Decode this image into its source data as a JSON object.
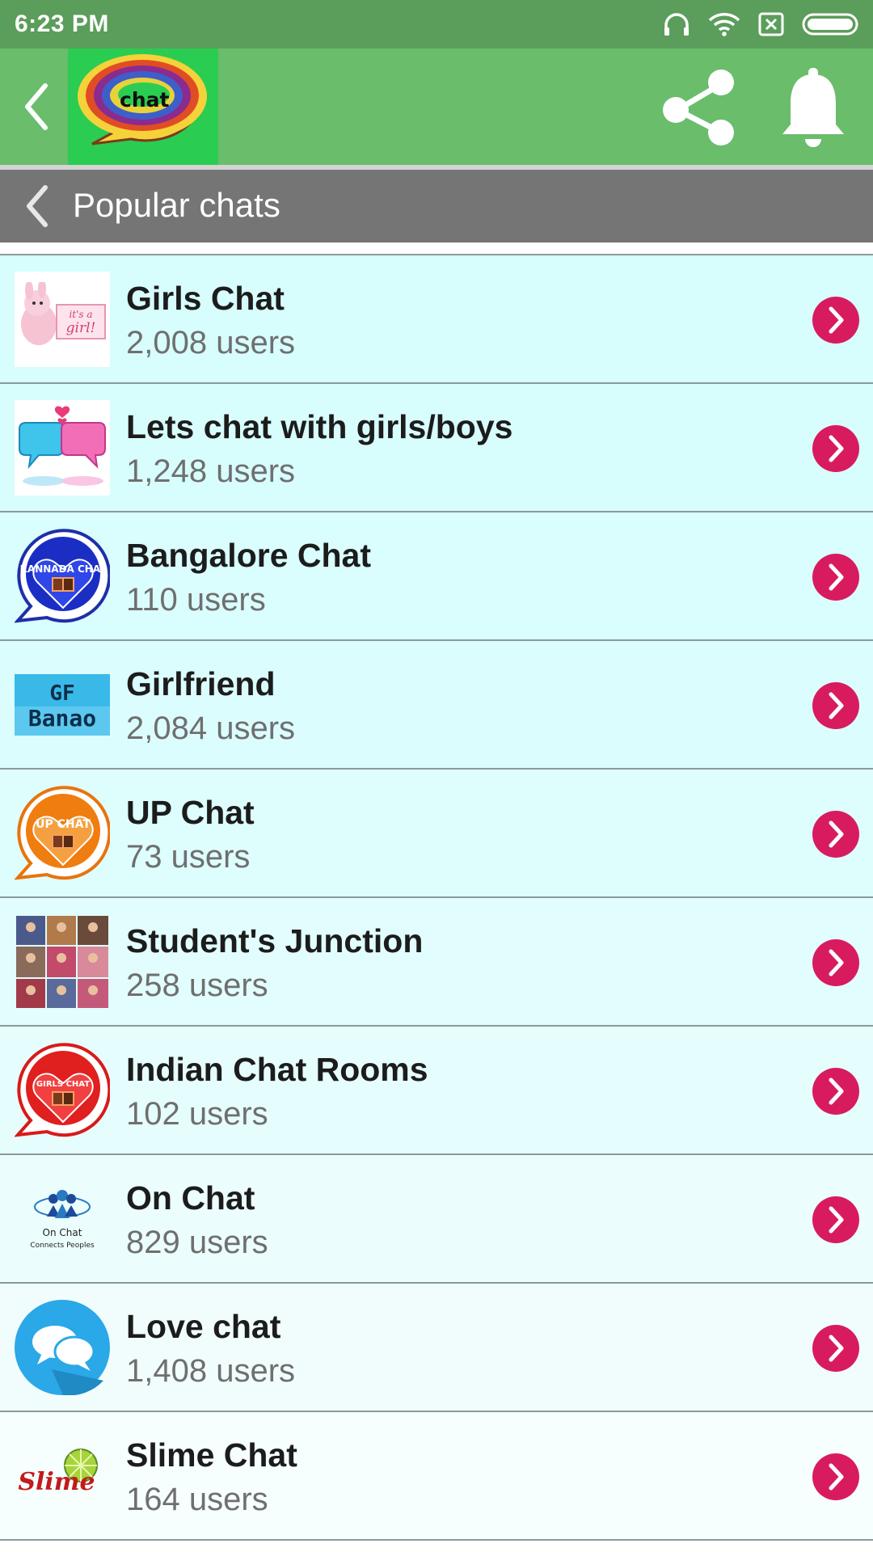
{
  "status_bar": {
    "time": "6:23 PM",
    "icons": [
      "headphones-icon",
      "wifi-icon",
      "no-sim-icon",
      "battery-icon"
    ]
  },
  "app_bar": {
    "logo_text": "chat",
    "back_icon": "chevron-left-icon",
    "share_icon": "share-icon",
    "bell_icon": "bell-icon"
  },
  "section": {
    "title": "Popular chats"
  },
  "colors": {
    "status_bar": "#5b9d5b",
    "app_bar": "#69bd6b",
    "logo_bg": "#2bcc52",
    "section_header": "#757575",
    "arrow": "#d81b5f"
  },
  "rooms": [
    {
      "title": "Girls Chat",
      "count": "2,008 users",
      "thumb_text": "it's a girl!",
      "icon": "girls-chat-thumbnail",
      "bg": "#d7fdfd"
    },
    {
      "title": "Lets chat with girls/boys",
      "count": "1,248 users",
      "thumb_text": "",
      "icon": "chat-bubbles-thumbnail",
      "bg": "#d8fdfd"
    },
    {
      "title": "Bangalore Chat",
      "count": "110 users",
      "thumb_text": "KANNADA CHAT",
      "icon": "kannada-chat-thumbnail",
      "bg": "#dafdfd"
    },
    {
      "title": "Girlfriend",
      "count": "2,084 users",
      "thumb_text": "GF Banao",
      "icon": "gf-banao-thumbnail",
      "bg": "#dcfdfd"
    },
    {
      "title": "UP Chat",
      "count": "73 users",
      "thumb_text": "UP CHAT",
      "icon": "up-chat-thumbnail",
      "bg": "#defdfd"
    },
    {
      "title": "Student's Junction",
      "count": "258 users",
      "thumb_text": "",
      "icon": "photo-collage-thumbnail",
      "bg": "#e2fdfd"
    },
    {
      "title": "Indian Chat Rooms",
      "count": "102 users",
      "thumb_text": "GIRLS CHAT",
      "icon": "girls-chat-heart-thumbnail",
      "bg": "#e6fdfd"
    },
    {
      "title": "On Chat",
      "count": "829 users",
      "thumb_text": "On Chat Connects Peoples",
      "icon": "on-chat-thumbnail",
      "bg": "#ecfdfd"
    },
    {
      "title": "Love chat",
      "count": "1,408 users",
      "thumb_text": "",
      "icon": "love-chat-thumbnail",
      "bg": "#f1fdfd"
    },
    {
      "title": "Slime Chat",
      "count": "164 users",
      "thumb_text": "Slime",
      "icon": "slime-chat-thumbnail",
      "bg": "#f6fefe"
    }
  ]
}
